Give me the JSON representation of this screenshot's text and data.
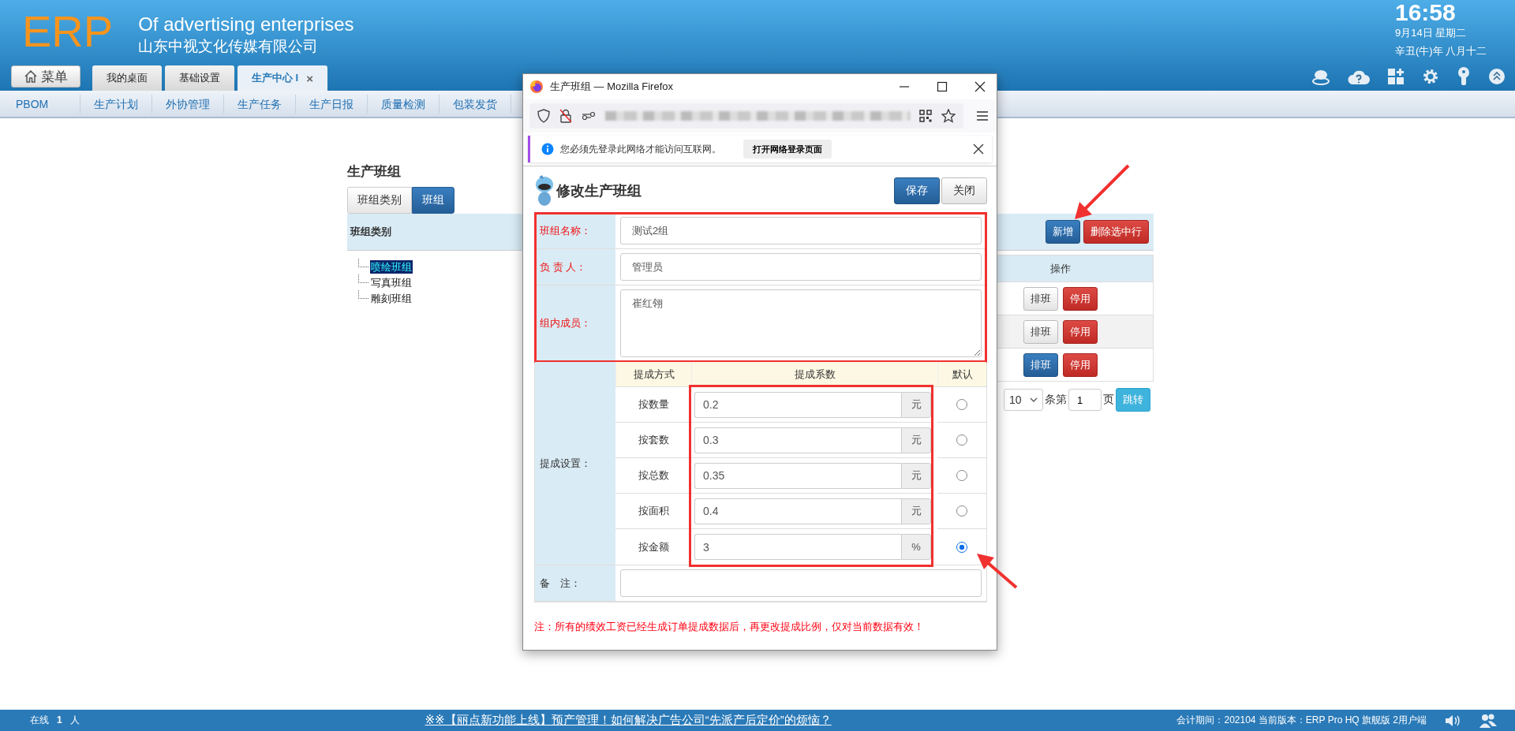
{
  "header": {
    "logo": "ERP",
    "title": "Of advertising enterprises",
    "company": "山东中视文化传媒有限公司",
    "time": "16:58",
    "date": "9月14日 星期二",
    "lunar": "辛丑(牛)年 八月十二"
  },
  "menu_button": "菜单",
  "tabs": [
    {
      "label": "我的桌面",
      "selected": false
    },
    {
      "label": "基础设置",
      "selected": false
    },
    {
      "label": "生产中心 I",
      "selected": true,
      "close": "×"
    }
  ],
  "submenu": [
    "PBOM",
    "生产计划",
    "外协管理",
    "生产任务",
    "生产日报",
    "质量检测",
    "包装发货"
  ],
  "page": {
    "title": "生产班组",
    "tabs": [
      {
        "label": "班组类别",
        "selected": false
      },
      {
        "label": "班组",
        "selected": true
      }
    ],
    "category_heading": "班组类别",
    "tree": [
      {
        "label": "喷绘班组",
        "selected": true
      },
      {
        "label": "写真班组",
        "selected": false
      },
      {
        "label": "雕刻班组",
        "selected": false
      }
    ],
    "add_button": "新增",
    "delete_button": "删除选中行",
    "table": {
      "columns": [
        "操作"
      ],
      "rows": [
        {
          "schedule": "排班",
          "highlighted": false,
          "disable": "停用"
        },
        {
          "schedule": "排班",
          "highlighted": false,
          "disable": "停用"
        },
        {
          "schedule": "排班",
          "highlighted": true,
          "disable": "停用"
        }
      ]
    },
    "pagination": {
      "page_size": "10",
      "per_page_label": "条第",
      "page": "1",
      "page_label": "页",
      "go": "跳转"
    }
  },
  "popup": {
    "title": "生产班组 — Mozilla Firefox",
    "notice": "您必须先登录此网络才能访问互联网。",
    "notice_button": "打开网络登录页面",
    "heading": "修改生产班组",
    "save": "保存",
    "close": "关闭",
    "fields": [
      {
        "label": "班组名称：",
        "value": "测试2组",
        "required": true,
        "kind": "input"
      },
      {
        "label": "负 责 人：",
        "value": "管理员",
        "required": true,
        "kind": "input"
      },
      {
        "label": "组内成员：",
        "value": "崔红翎",
        "required": true,
        "kind": "textarea"
      }
    ],
    "commission": {
      "label": "提成设置：",
      "columns": [
        "提成方式",
        "提成系数",
        "默认"
      ],
      "rows": [
        {
          "method": "按数量",
          "value": "0.2",
          "unit": "元",
          "selected": false
        },
        {
          "method": "按套数",
          "value": "0.3",
          "unit": "元",
          "selected": false
        },
        {
          "method": "按总数",
          "value": "0.35",
          "unit": "元",
          "selected": false
        },
        {
          "method": "按面积",
          "value": "0.4",
          "unit": "元",
          "selected": false
        },
        {
          "method": "按金额",
          "value": "3",
          "unit": "%",
          "selected": true
        }
      ]
    },
    "remark": {
      "label": "备　注：",
      "required": false
    },
    "warning": "注：所有的绩效工资已经生成订单提成数据后，再更改提成比例，仅对当前数据有效！"
  },
  "status_bar": {
    "online_label": "在线",
    "online_count": "1",
    "online_unit": "人",
    "news": "※※【丽点新功能上线】预产管理！如何解决广告公司“先派产后定价”的烦恼？",
    "info": "会计期间：202104 当前版本：ERP Pro HQ 旗舰版 2用户端"
  }
}
